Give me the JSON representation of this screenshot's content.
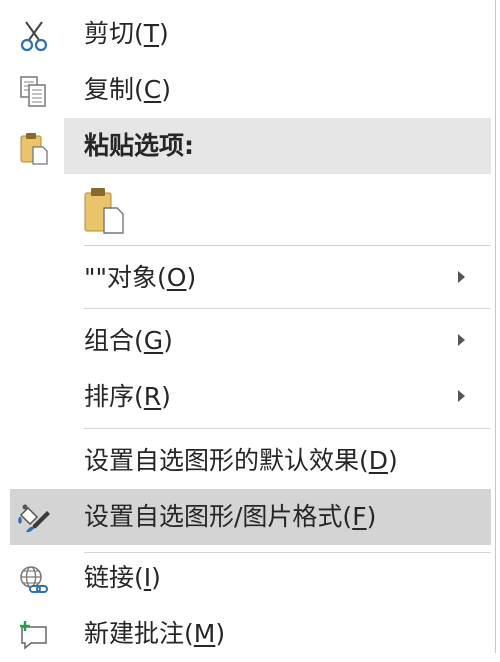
{
  "menu": {
    "cut": {
      "label": "剪切(",
      "key": "T",
      "tail": ")",
      "icon": "scissors-icon"
    },
    "copy": {
      "label": "复制(",
      "key": "C",
      "tail": ")",
      "icon": "copy-icon"
    },
    "paste_header": {
      "label": "粘贴选项:",
      "icon": "clipboard-icon"
    },
    "paste_option": {
      "icon": "paste-clipboard-icon"
    },
    "object": {
      "label": "\"\"对象(",
      "key": "O",
      "tail": ")",
      "submenu": true
    },
    "group": {
      "label": "组合(",
      "key": "G",
      "tail": ")",
      "submenu": true
    },
    "order": {
      "label": "排序(",
      "key": "R",
      "tail": ")",
      "submenu": true
    },
    "set_default": {
      "label": "设置自选图形的默认效果(",
      "key": "D",
      "tail": ")"
    },
    "format": {
      "label": "设置自选图形/图片格式(",
      "key": "F",
      "tail": ")",
      "icon": "format-shape-icon",
      "highlighted": true
    },
    "link": {
      "label": "链接(",
      "key": "I",
      "tail": ")",
      "icon": "link-globe-icon"
    },
    "new_comment": {
      "label": "新建批注(",
      "key": "M",
      "tail": ")",
      "icon": "new-comment-icon"
    }
  }
}
